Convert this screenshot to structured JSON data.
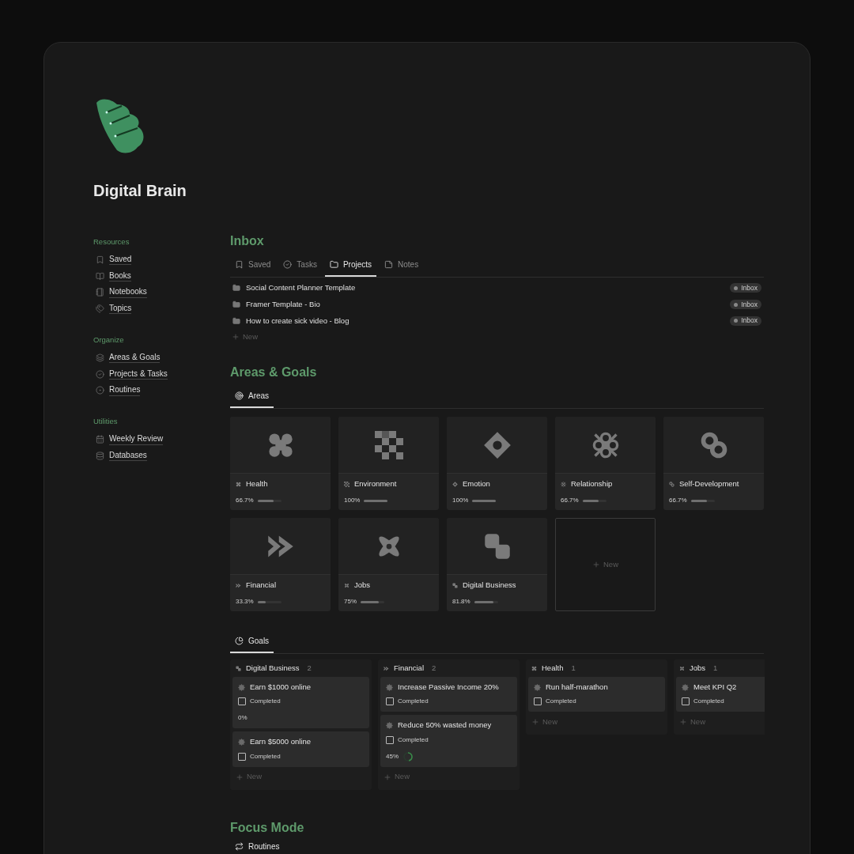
{
  "brand": {
    "title": "Digital Brain"
  },
  "sidebar": {
    "sections": [
      {
        "heading": "Resources",
        "items": [
          "Saved",
          "Books",
          "Notebooks",
          "Topics"
        ]
      },
      {
        "heading": "Organize",
        "items": [
          "Areas & Goals",
          "Projects & Tasks",
          "Routines"
        ]
      },
      {
        "heading": "Utilities",
        "items": [
          "Weekly Review",
          "Databases"
        ]
      }
    ]
  },
  "inbox": {
    "title": "Inbox",
    "tabs": [
      {
        "label": "Saved",
        "selected": false
      },
      {
        "label": "Tasks",
        "selected": false
      },
      {
        "label": "Projects",
        "selected": true
      },
      {
        "label": "Notes",
        "selected": false
      }
    ],
    "rows": [
      {
        "title": "Social Content Planner Template",
        "tag": "Inbox"
      },
      {
        "title": "Framer Template - Bio",
        "tag": "Inbox"
      },
      {
        "title": "How to create sick video - Blog",
        "tag": "Inbox"
      }
    ],
    "new_label": "New"
  },
  "areas_goals": {
    "title": "Areas & Goals",
    "areas_tab": {
      "label": "Areas",
      "selected": true
    },
    "areas": [
      {
        "name": "Health",
        "progress": "66.7%",
        "level": 0.667
      },
      {
        "name": "Environment",
        "progress": "100%",
        "level": 1
      },
      {
        "name": "Emotion",
        "progress": "100%",
        "level": 1
      },
      {
        "name": "Relationship",
        "progress": "66.7%",
        "level": 0.667
      },
      {
        "name": "Self-Development",
        "progress": "66.7%",
        "level": 0.667
      },
      {
        "name": "Financial",
        "progress": "33.3%",
        "level": 0.333
      },
      {
        "name": "Jobs",
        "progress": "75%",
        "level": 0.75
      },
      {
        "name": "Digital Business",
        "progress": "81.8%",
        "level": 0.818
      }
    ],
    "new_area_label": "New",
    "goals_tab": {
      "label": "Goals",
      "selected": true
    },
    "goal_groups": [
      {
        "name": "Digital Business",
        "count": "2",
        "goals": [
          {
            "title": "Earn $1000 online",
            "status": "Completed",
            "checked": false,
            "progress": "0%"
          },
          {
            "title": "Earn $5000 online",
            "status": "Completed",
            "checked": false
          }
        ],
        "new_label": "New"
      },
      {
        "name": "Financial",
        "count": "2",
        "goals": [
          {
            "title": "Increase Passive Income 20%",
            "status": "Completed",
            "checked": false
          },
          {
            "title": "Reduce 50% wasted money",
            "status": "Completed",
            "checked": false,
            "progress": "45%",
            "level": 0.45
          }
        ],
        "new_label": "New"
      },
      {
        "name": "Health",
        "count": "1",
        "goals": [
          {
            "title": "Run half-marathon",
            "status": "Completed",
            "checked": false
          }
        ],
        "new_label": "New"
      },
      {
        "name": "Jobs",
        "count": "1",
        "goals": [
          {
            "title": "Meet KPI Q2",
            "status": "Completed",
            "checked": false
          }
        ],
        "new_label": "New"
      }
    ]
  },
  "focus_mode": {
    "title": "Focus Mode",
    "tab": {
      "label": "Routines",
      "selected": true
    }
  }
}
